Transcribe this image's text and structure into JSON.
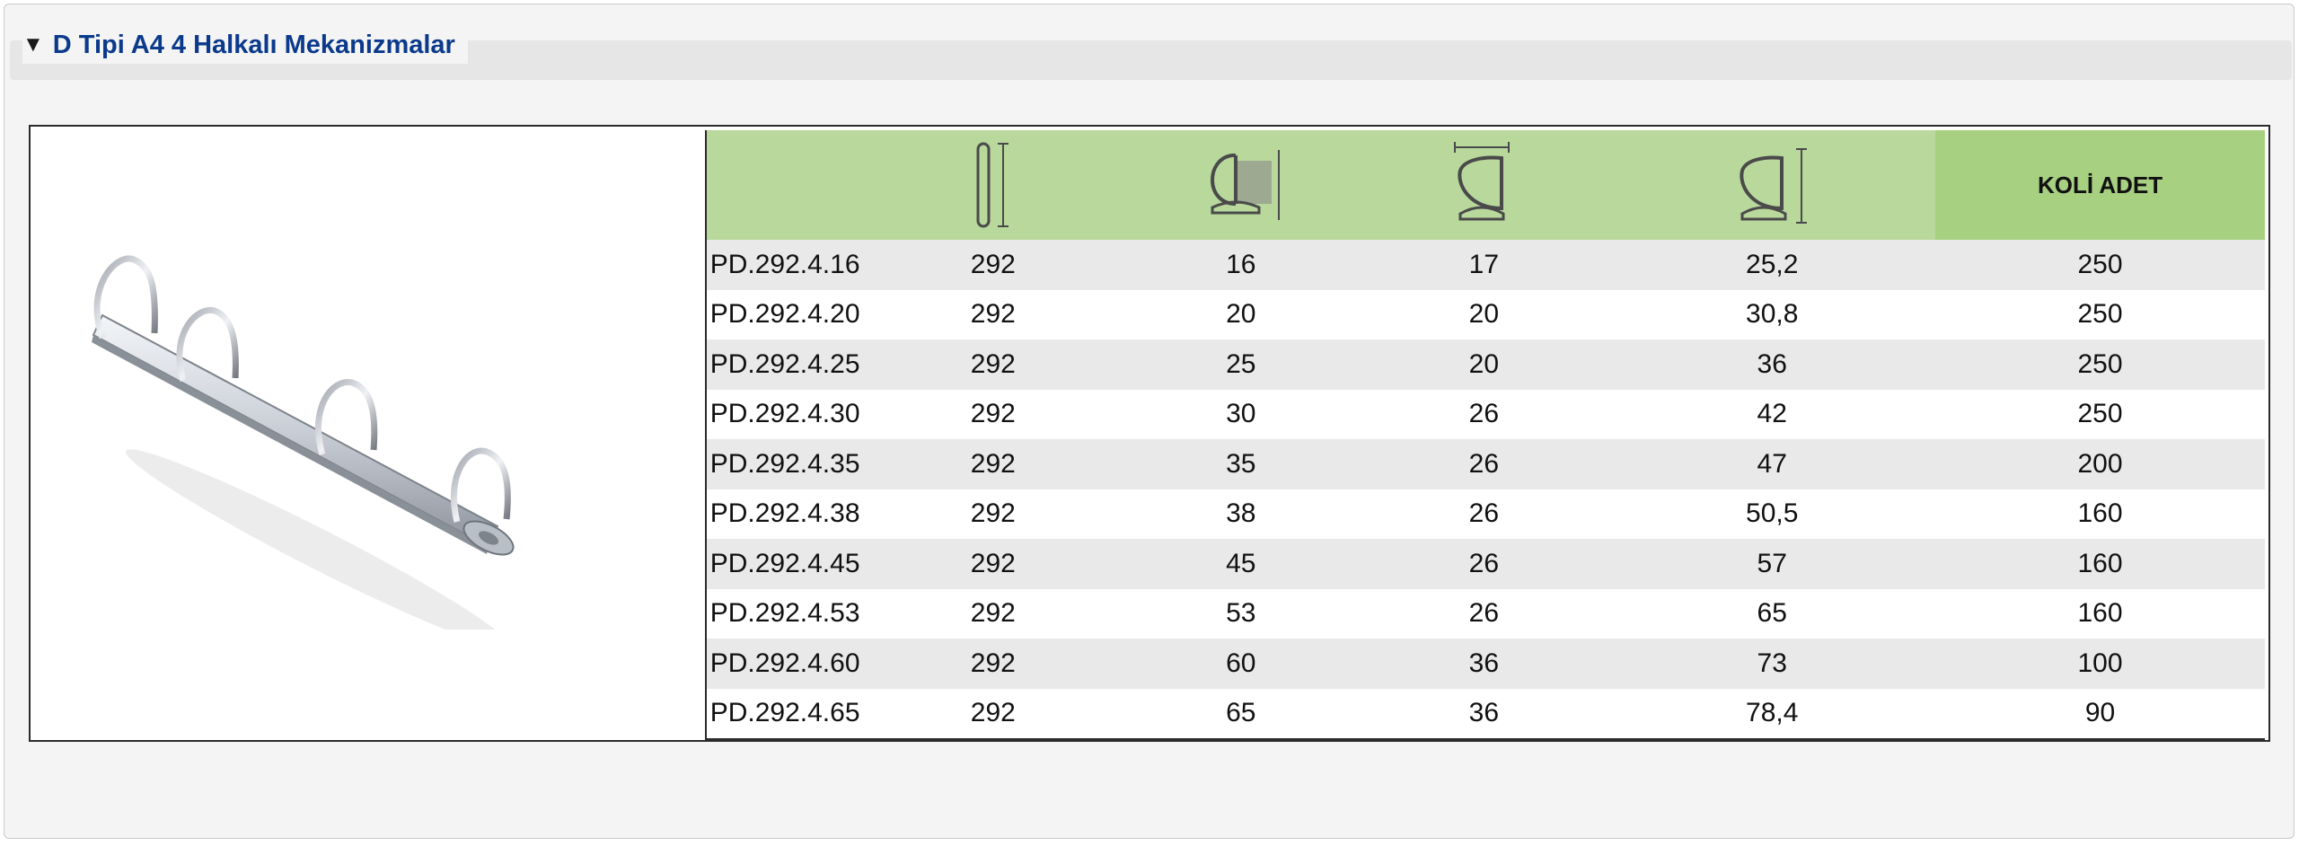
{
  "section": {
    "title": "D Tipi A4 4 Halkalı Mekanizmalar",
    "toggle_icon": "triangle-down-icon"
  },
  "product": {
    "image": "four-d-ring-binder-mechanism"
  },
  "table": {
    "header": {
      "col1": "",
      "col2_icon": "mechanism-length-icon",
      "col3_icon": "ring-capacity-icon",
      "col4_icon": "ring-width-icon",
      "col5_icon": "ring-height-icon",
      "col6": "KOLİ ADET"
    },
    "rows": [
      [
        "PD.292.4.16",
        "292",
        "16",
        "17",
        "25,2",
        "250"
      ],
      [
        "PD.292.4.20",
        "292",
        "20",
        "20",
        "30,8",
        "250"
      ],
      [
        "PD.292.4.25",
        "292",
        "25",
        "20",
        "36",
        "250"
      ],
      [
        "PD.292.4.30",
        "292",
        "30",
        "26",
        "42",
        "250"
      ],
      [
        "PD.292.4.35",
        "292",
        "35",
        "26",
        "47",
        "200"
      ],
      [
        "PD.292.4.38",
        "292",
        "38",
        "26",
        "50,5",
        "160"
      ],
      [
        "PD.292.4.45",
        "292",
        "45",
        "26",
        "57",
        "160"
      ],
      [
        "PD.292.4.53",
        "292",
        "53",
        "26",
        "65",
        "160"
      ],
      [
        "PD.292.4.60",
        "292",
        "60",
        "36",
        "73",
        "100"
      ],
      [
        "PD.292.4.65",
        "292",
        "65",
        "36",
        "78,4",
        "90"
      ]
    ]
  }
}
